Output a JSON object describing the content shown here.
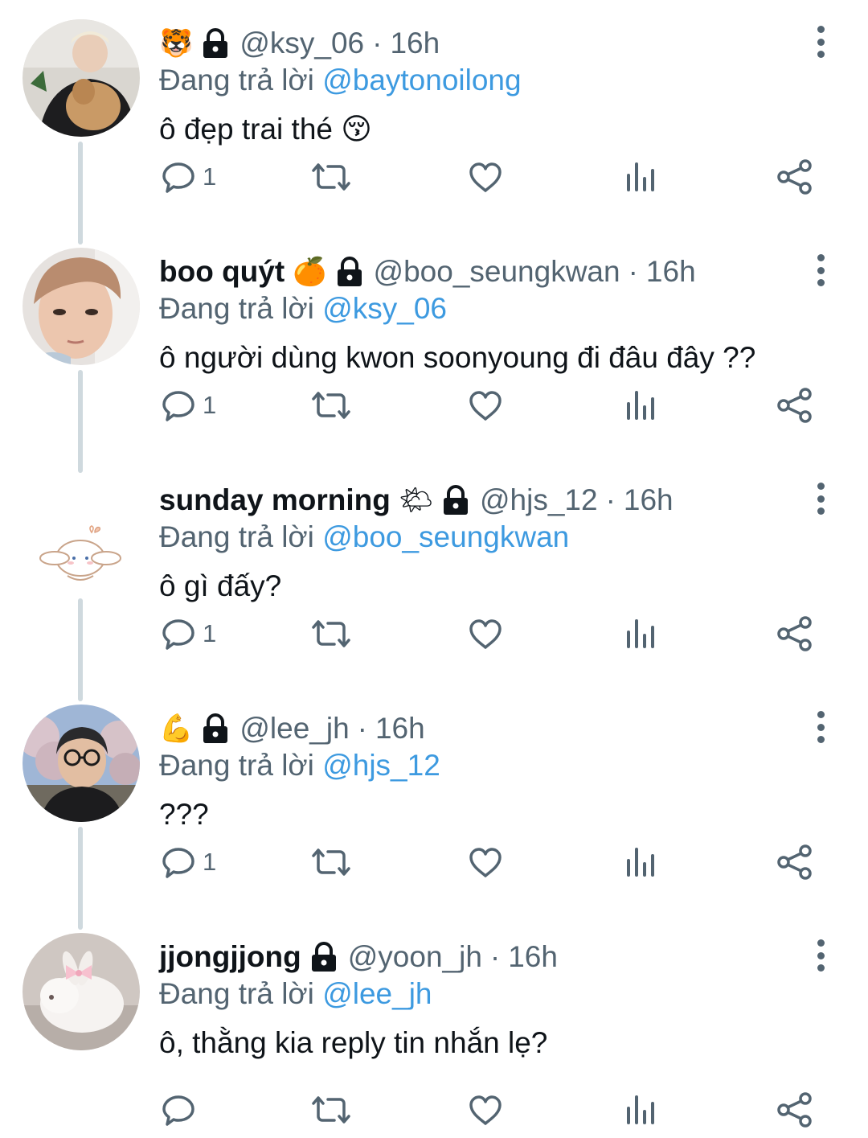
{
  "colors": {
    "accent": "#3d9ae0",
    "secondary_text": "#536471",
    "primary_text": "#0f1419",
    "thread_line": "#cfd9de"
  },
  "reply_prefix": "Đang trả lời",
  "tweets": [
    {
      "display_name": "",
      "emoji": "🐯",
      "locked": true,
      "handle": "@ksy_06",
      "separator": "·",
      "time": "16h",
      "reply_to": "@baytonoilong",
      "text": "ô đẹp trai thé 😚",
      "reply_count": "1",
      "avatar": "person-with-dog"
    },
    {
      "display_name": "boo quýt",
      "emoji": "🍊",
      "locked": true,
      "handle": "@boo_seungkwan",
      "separator": "·",
      "time": "16h",
      "reply_to": "@ksy_06",
      "text": "ô người dùng kwon soonyoung đi đâu đây ??",
      "reply_count": "1",
      "avatar": "selfie-person"
    },
    {
      "display_name": "sunday morning",
      "emoji": "🌤",
      "locked": true,
      "handle": "@hjs_12",
      "separator": "·",
      "time": "16h",
      "reply_to": "@boo_seungkwan",
      "text": "ô gì đấy?",
      "reply_count": "1",
      "avatar": "cartoon-puppy"
    },
    {
      "display_name": "",
      "emoji": "💪",
      "locked": true,
      "handle": "@lee_jh",
      "separator": "·",
      "time": "16h",
      "reply_to": "@hjs_12",
      "text": "???",
      "reply_count": "1",
      "avatar": "person-cherry-blossom"
    },
    {
      "display_name": "jjongjjong",
      "emoji": "",
      "locked": true,
      "handle": "@yoon_jh",
      "separator": "·",
      "time": "16h",
      "reply_to": "@lee_jh",
      "text": "ô, thằng kia reply tin nhắn lẹ?",
      "reply_count": "",
      "avatar": "white-bunny-with-bow"
    }
  ]
}
